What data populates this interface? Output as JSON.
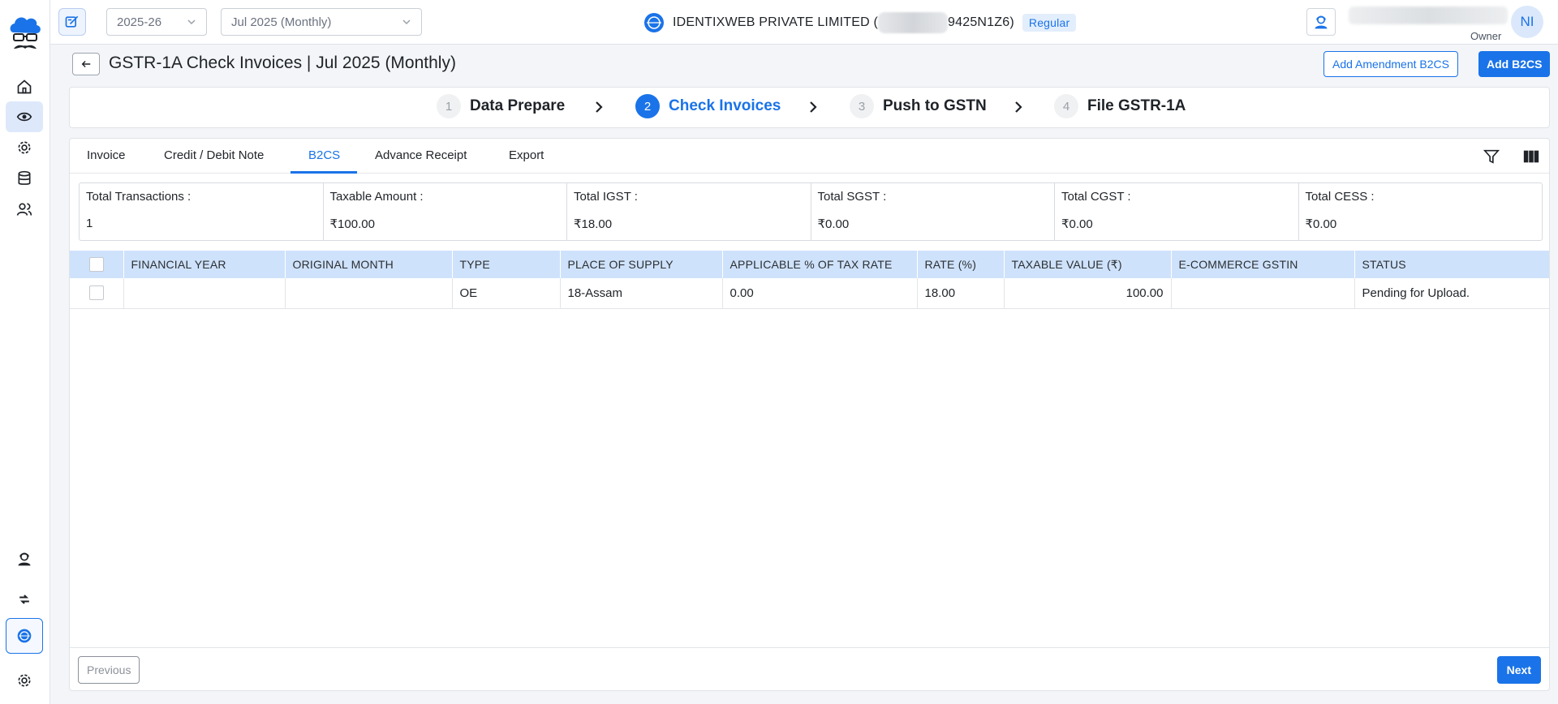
{
  "topbar": {
    "financial_year": "2025-26",
    "period": "Jul 2025 (Monthly)",
    "company_name_prefix": "IDENTIXWEB PRIVATE LIMITED (",
    "company_gstin_suffix": "9425N1Z6)",
    "registration_type": "Regular",
    "user_initials": "NI",
    "user_role": "Owner"
  },
  "header": {
    "title": "GSTR-1A Check Invoices | Jul 2025 (Monthly)",
    "add_amendment_label": "Add Amendment B2CS",
    "add_b2cs_label": "Add B2CS"
  },
  "stepper": {
    "steps": [
      {
        "num": "1",
        "label": "Data Prepare"
      },
      {
        "num": "2",
        "label": "Check Invoices"
      },
      {
        "num": "3",
        "label": "Push to GSTN"
      },
      {
        "num": "4",
        "label": "File GSTR-1A"
      }
    ],
    "active_step": 2
  },
  "tabs": [
    {
      "label": "Invoice"
    },
    {
      "label": "Credit / Debit Note"
    },
    {
      "label": "B2CS"
    },
    {
      "label": "Advance Receipt"
    },
    {
      "label": "Export"
    }
  ],
  "summary": [
    {
      "label": "Total Transactions :",
      "value": "1"
    },
    {
      "label": "Taxable Amount :",
      "value": "₹100.00"
    },
    {
      "label": "Total IGST :",
      "value": "₹18.00"
    },
    {
      "label": "Total SGST :",
      "value": "₹0.00"
    },
    {
      "label": "Total CGST :",
      "value": "₹0.00"
    },
    {
      "label": "Total CESS :",
      "value": "₹0.00"
    }
  ],
  "table": {
    "columns": [
      "FINANCIAL YEAR",
      "ORIGINAL MONTH",
      "TYPE",
      "PLACE OF SUPPLY",
      "APPLICABLE % OF TAX RATE",
      "RATE (%)",
      "TAXABLE VALUE (₹)",
      "E-COMMERCE GSTIN",
      "STATUS"
    ],
    "rows": [
      {
        "financial_year": "",
        "original_month": "",
        "type": "OE",
        "place_of_supply": "18-Assam",
        "applicable_pct": "0.00",
        "rate": "18.00",
        "taxable_value": "100.00",
        "ecommerce_gstin": "",
        "status": "Pending for Upload."
      }
    ]
  },
  "footer": {
    "previous_label": "Previous",
    "next_label": "Next"
  },
  "colors": {
    "accent": "#1a73e8",
    "table_header_bg": "#cfe2fb",
    "active_rail_bg": "#dde9fb"
  }
}
